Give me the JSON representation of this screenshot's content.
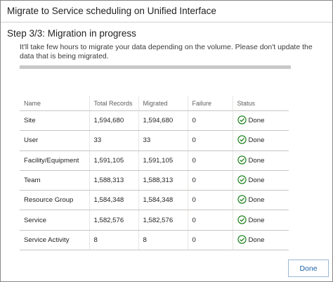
{
  "dialog": {
    "title": "Migrate to Service scheduling on Unified Interface",
    "step_title": "Step 3/3: Migration in progress",
    "description": "It'll take few hours to migrate your data depending on the volume. Please don't update the data that is being migrated."
  },
  "progress": {
    "percent": 100
  },
  "table": {
    "headers": {
      "name": "Name",
      "total": "Total Records",
      "migrated": "Migrated",
      "failure": "Failure",
      "status": "Status"
    },
    "rows": [
      {
        "name": "Site",
        "total": "1,594,680",
        "migrated": "1,594,680",
        "failure": "0",
        "status": "Done"
      },
      {
        "name": "User",
        "total": "33",
        "migrated": "33",
        "failure": "0",
        "status": "Done"
      },
      {
        "name": "Facility/Equipment",
        "total": "1,591,105",
        "migrated": "1,591,105",
        "failure": "0",
        "status": "Done"
      },
      {
        "name": "Team",
        "total": "1,588,313",
        "migrated": "1,588,313",
        "failure": "0",
        "status": "Done"
      },
      {
        "name": "Resource Group",
        "total": "1,584,348",
        "migrated": "1,584,348",
        "failure": "0",
        "status": "Done"
      },
      {
        "name": "Service",
        "total": "1,582,576",
        "migrated": "1,582,576",
        "failure": "0",
        "status": "Done"
      },
      {
        "name": "Service Activity",
        "total": "8",
        "migrated": "8",
        "failure": "0",
        "status": "Done"
      }
    ],
    "status_icon": "check-circle-icon",
    "status_color": "#107c10"
  },
  "footer": {
    "done_label": "Done"
  },
  "colors": {
    "accent": "#1a5fa8",
    "progress": "#c8c8c8"
  }
}
